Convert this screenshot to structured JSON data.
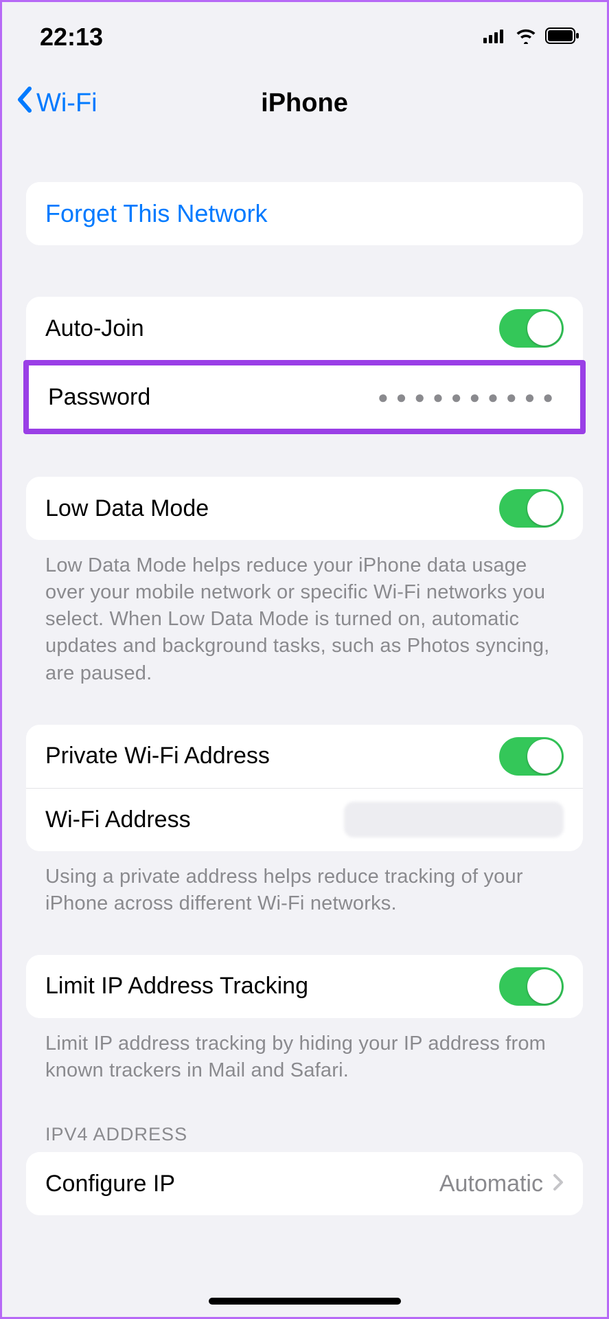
{
  "status": {
    "time": "22:13"
  },
  "nav": {
    "back_label": "Wi-Fi",
    "title": "iPhone"
  },
  "forget": {
    "label": "Forget This Network"
  },
  "auto_join": {
    "label": "Auto-Join"
  },
  "password": {
    "label": "Password",
    "value": "●●●●●●●●●●"
  },
  "low_data": {
    "label": "Low Data Mode",
    "footer": "Low Data Mode helps reduce your iPhone data usage over your mobile network or specific Wi-Fi networks you select. When Low Data Mode is turned on, automatic updates and background tasks, such as Photos syncing, are paused."
  },
  "private_addr": {
    "label": "Private Wi-Fi Address"
  },
  "wifi_addr": {
    "label": "Wi-Fi Address"
  },
  "private_footer": "Using a private address helps reduce tracking of your iPhone across different Wi-Fi networks.",
  "limit_ip": {
    "label": "Limit IP Address Tracking",
    "footer": "Limit IP address tracking by hiding your IP address from known trackers in Mail and Safari."
  },
  "ipv4": {
    "header": "IPV4 ADDRESS",
    "configure_label": "Configure IP",
    "configure_value": "Automatic"
  }
}
